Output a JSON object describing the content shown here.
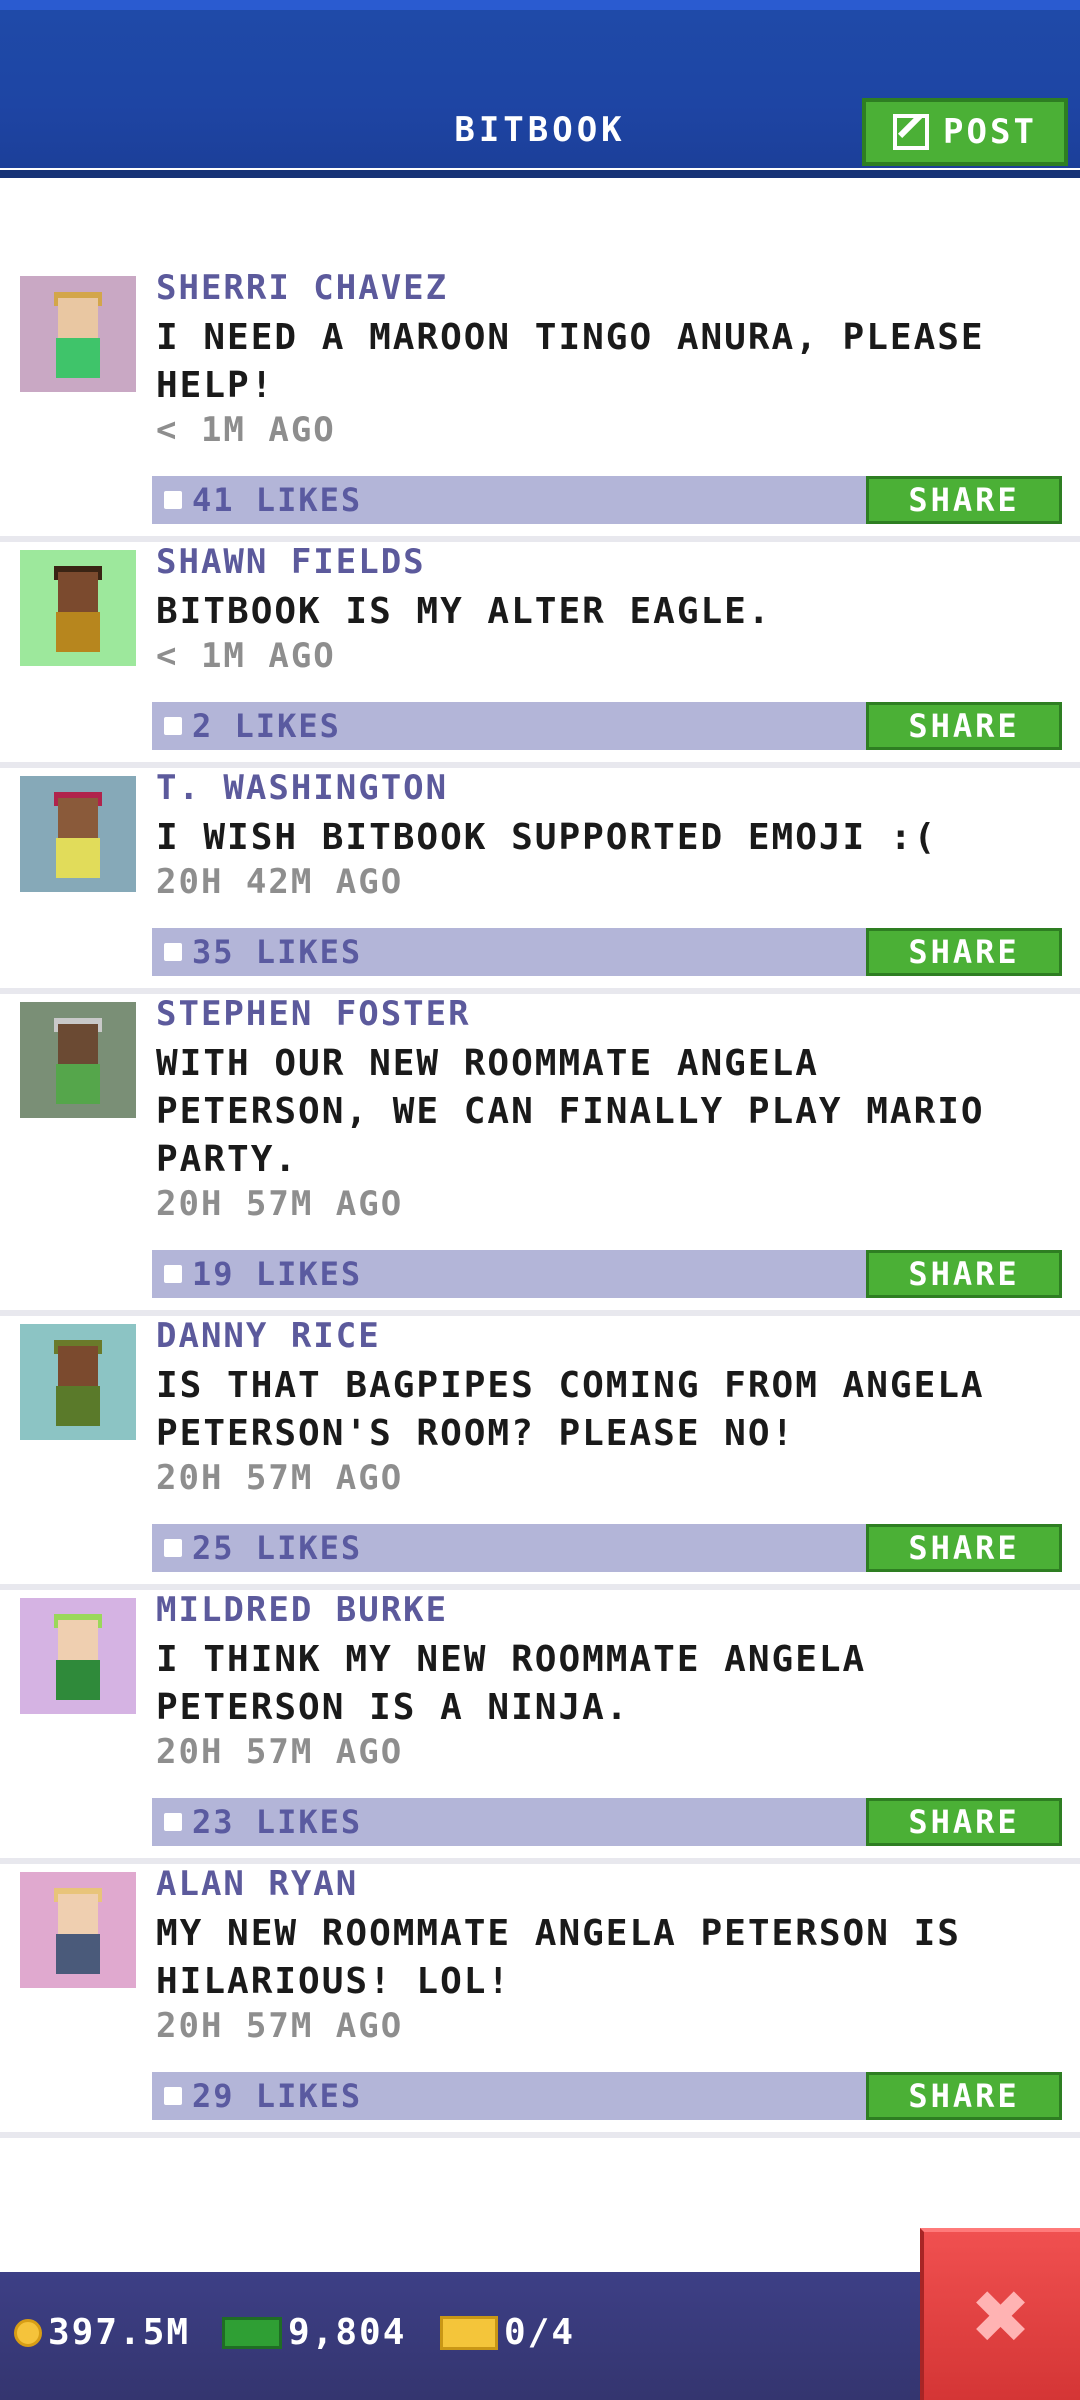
{
  "header": {
    "title": "BITBOOK",
    "post_label": "POST"
  },
  "posts": [
    {
      "name": "SHERRI CHAVEZ",
      "lines": [
        "I NEED A MAROON TINGO ANURA, PLEASE",
        "HELP!"
      ],
      "time": "< 1M AGO",
      "likes": "41 LIKES",
      "share": "SHARE",
      "colors": {
        "bg": "#c9a8c4",
        "skin": "#e9c7a2",
        "body": "#3fc46a",
        "hair": "#d3a64a"
      }
    },
    {
      "name": "SHAWN FIELDS",
      "lines": [
        "BITBOOK IS MY ALTER EAGLE."
      ],
      "time": "< 1M AGO",
      "likes": "2 LIKES",
      "share": "SHARE",
      "colors": {
        "bg": "#9de89c",
        "skin": "#7b4a2e",
        "body": "#b7861e",
        "hair": "#3a2414"
      }
    },
    {
      "name": "T. WASHINGTON",
      "lines": [
        "I WISH BITBOOK SUPPORTED EMOJI :("
      ],
      "time": "20H 42M AGO",
      "likes": "35 LIKES",
      "share": "SHARE",
      "colors": {
        "bg": "#86a9b8",
        "skin": "#8a5a3a",
        "body": "#e1dc5a",
        "hair": "#b0234b"
      }
    },
    {
      "name": "STEPHEN FOSTER",
      "lines": [
        "WITH OUR NEW ROOMMATE ANGELA",
        "PETERSON, WE CAN FINALLY PLAY MARIO",
        "PARTY."
      ],
      "time": "20H 57M AGO",
      "likes": "19 LIKES",
      "share": "SHARE",
      "colors": {
        "bg": "#7a8f76",
        "skin": "#6b4a33",
        "body": "#55a64b",
        "hair": "#c9c9c9"
      }
    },
    {
      "name": "DANNY RICE",
      "lines": [
        "IS THAT BAGPIPES COMING FROM ANGELA",
        "PETERSON'S ROOM? PLEASE NO!"
      ],
      "time": "20H 57M AGO",
      "likes": "25 LIKES",
      "share": "SHARE",
      "colors": {
        "bg": "#8cc4c4",
        "skin": "#7b4a2e",
        "body": "#5a7a2a",
        "hair": "#6a7a2a"
      }
    },
    {
      "name": "MILDRED BURKE",
      "lines": [
        "I THINK MY NEW ROOMMATE ANGELA",
        "PETERSON IS A NINJA."
      ],
      "time": "20H 57M AGO",
      "likes": "23 LIKES",
      "share": "SHARE",
      "colors": {
        "bg": "#d5b3e3",
        "skin": "#efcfb0",
        "body": "#2f8a3a",
        "hair": "#9ad85a"
      }
    },
    {
      "name": "ALAN RYAN",
      "lines": [
        "MY NEW ROOMMATE ANGELA PETERSON IS",
        "HILARIOUS! LOL!"
      ],
      "time": "20H 57M AGO",
      "likes": "29 LIKES",
      "share": "SHARE",
      "colors": {
        "bg": "#e0a9cf",
        "skin": "#efcfb0",
        "body": "#4a5a7a",
        "hair": "#e8c47a"
      }
    }
  ],
  "bottombar": {
    "coins": "397.5M",
    "bux": "9,804",
    "tickets": "0/4"
  },
  "icons": {
    "post": "edit-icon",
    "close": "close-icon",
    "coin": "coin-icon",
    "bux": "bux-icon",
    "ticket": "ticket-icon"
  }
}
